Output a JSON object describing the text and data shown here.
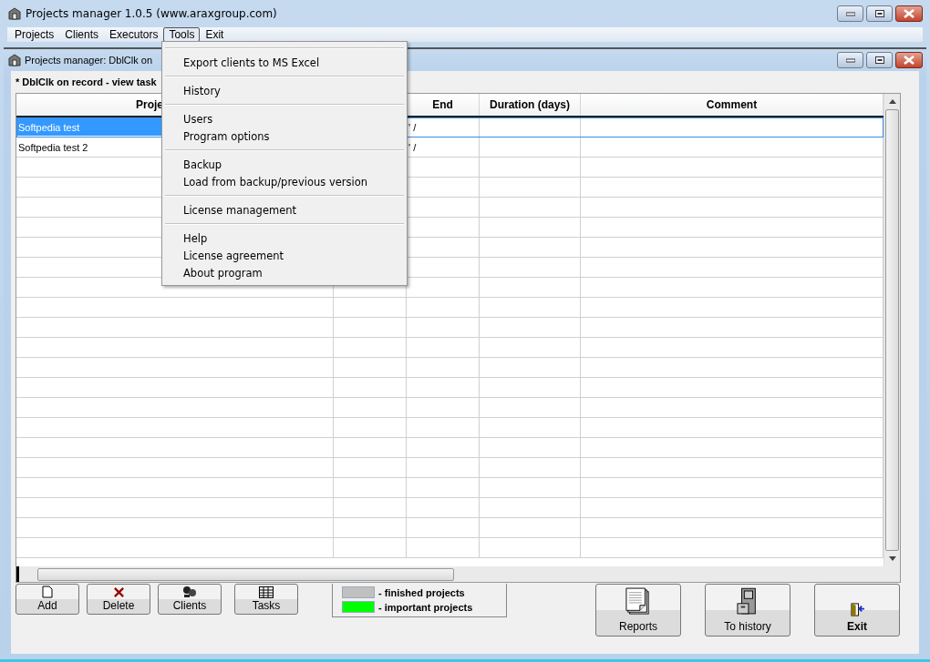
{
  "window": {
    "title": "Projects manager 1.0.5 (www.araxgroup.com)"
  },
  "menu": [
    {
      "label": "Projects",
      "selected": false
    },
    {
      "label": "Clients",
      "selected": false
    },
    {
      "label": "Executors",
      "selected": false
    },
    {
      "label": "Tools",
      "selected": true
    },
    {
      "label": "Exit",
      "selected": false
    }
  ],
  "tools_menu": [
    [
      "Export clients to MS Excel"
    ],
    [
      "History"
    ],
    [
      "Users",
      "Program options"
    ],
    [
      "Backup",
      "Load from backup/previous version"
    ],
    [
      "License management"
    ],
    [
      "Help",
      "License agreement",
      "About program"
    ]
  ],
  "inner_window": {
    "title": "Projects manager: DblClk on"
  },
  "hint": "* DblClk on record - view task",
  "table": {
    "columns": [
      "Proje",
      "End",
      "Duration (days)",
      "Comment"
    ],
    "rows": [
      {
        "project": "Softpedia test",
        "end": "' /",
        "selected": true
      },
      {
        "project": "Softpedia test 2",
        "end": "' /",
        "selected": false
      }
    ]
  },
  "small_buttons": [
    {
      "label": "Add",
      "kind": "add"
    },
    {
      "label": "Delete",
      "kind": "delete"
    },
    {
      "label": "Clients",
      "kind": "clients"
    },
    {
      "label": "Tasks",
      "kind": "tasks"
    }
  ],
  "legend": [
    {
      "label": "- finished projects",
      "color": "#c0c0c0"
    },
    {
      "label": "- important projects",
      "color": "#00ff00"
    }
  ],
  "big_buttons": [
    {
      "label": "Reports",
      "kind": "reports",
      "bold": false
    },
    {
      "label": "To history",
      "kind": "history",
      "bold": false
    },
    {
      "label": "Exit",
      "kind": "exit",
      "bold": true
    }
  ]
}
